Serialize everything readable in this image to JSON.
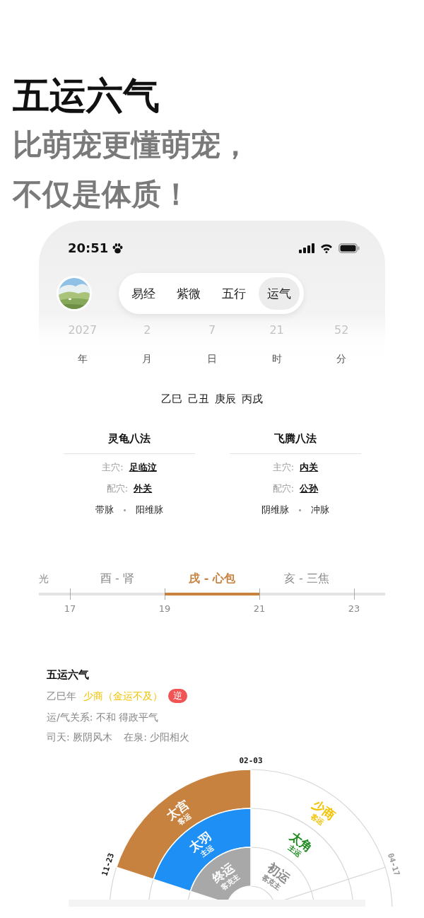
{
  "headline": {
    "title": "五运六气",
    "subtitle_lines": [
      "比萌宠更懂萌宠，",
      "不仅是体质！"
    ]
  },
  "status_bar": {
    "time": "20:51"
  },
  "tabs": [
    {
      "label": "易经",
      "selected": false
    },
    {
      "label": "紫微",
      "selected": false
    },
    {
      "label": "五行",
      "selected": false
    },
    {
      "label": "运气",
      "selected": true
    }
  ],
  "date_picker": [
    {
      "value": "2027",
      "unit": "年"
    },
    {
      "value": "2",
      "unit": "月"
    },
    {
      "value": "7",
      "unit": "日"
    },
    {
      "value": "21",
      "unit": "时"
    },
    {
      "value": "52",
      "unit": "分"
    }
  ],
  "ganzhi": "乙巳 己丑 庚辰 丙戌",
  "methods": [
    {
      "title": "灵龟八法",
      "rows": [
        {
          "label": "主穴:",
          "value": "足临泣"
        },
        {
          "label": "配穴:",
          "value": "外关"
        }
      ],
      "channels": [
        "带脉",
        "阳维脉"
      ]
    },
    {
      "title": "飞腾八法",
      "rows": [
        {
          "label": "主穴:",
          "value": "内关"
        },
        {
          "label": "配穴:",
          "value": "公孙"
        }
      ],
      "channels": [
        "阴维脉",
        "冲脉"
      ]
    }
  ],
  "timeline": {
    "segments": [
      {
        "label": "光",
        "selected": false
      },
      {
        "label": "酉 - 肾",
        "selected": false
      },
      {
        "label": "戌 - 心包",
        "selected": true
      },
      {
        "label": "亥 - 三焦",
        "selected": false
      }
    ],
    "ticks": [
      "17",
      "19",
      "21",
      "23"
    ]
  },
  "yun_qi": {
    "title": "五运六气",
    "year": "乙巳年",
    "yun": "少商（金运不及）",
    "badge": "逆",
    "relation": "运/气关系: 不和 得政平气",
    "sitian": "司天:  厥阴风木",
    "zaiquan": "在泉:  少阳相火"
  },
  "wheel": {
    "date_marks": [
      {
        "text": "02-03",
        "color": "#111111"
      },
      {
        "text": "11-23",
        "color": "#111111"
      },
      {
        "text": "04-17",
        "color": "#999999"
      }
    ],
    "rings": [
      [
        {
          "name": "太宫",
          "role": "客运",
          "color": "#c8823f",
          "filled": true
        },
        {
          "name": "少商",
          "role": "客运",
          "color": "#f2c200",
          "filled": false
        }
      ],
      [
        {
          "name": "太羽",
          "role": "主运",
          "color": "#1e8ff5",
          "filled": true
        },
        {
          "name": "太角",
          "role": "主运",
          "color": "#1d8a1d",
          "filled": false
        }
      ],
      [
        {
          "name": "终运",
          "role": "客克主",
          "color": "#a8a8a8",
          "filled": true
        },
        {
          "name": "初运",
          "role": "客克主",
          "color": "#888888",
          "filled": false
        }
      ]
    ]
  }
}
